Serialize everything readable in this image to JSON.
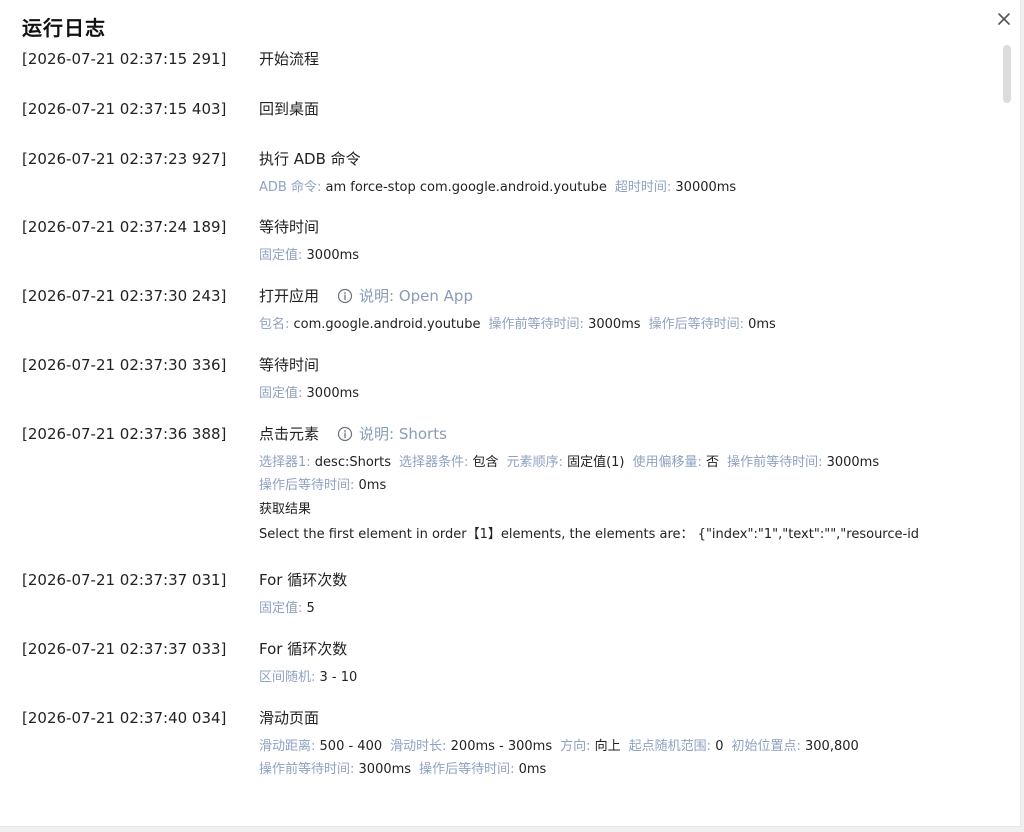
{
  "dialog": {
    "title": "运行日志"
  },
  "log": [
    {
      "ts": "[2026-07-21 02:37:15 291]",
      "title": "开始流程"
    },
    {
      "ts": "[2026-07-21 02:37:15 403]",
      "title": "回到桌面"
    },
    {
      "ts": "[2026-07-21 02:37:23 927]",
      "title": "执行 ADB 命令",
      "line1": [
        {
          "k": "ADB 命令:",
          "v": "am force-stop com.google.android.youtube"
        },
        {
          "k": "超时时间:",
          "v": "30000ms"
        }
      ]
    },
    {
      "ts": "[2026-07-21 02:37:24 189]",
      "title": "等待时间",
      "line1": [
        {
          "k": "固定值:",
          "v": "3000ms"
        }
      ]
    },
    {
      "ts": "[2026-07-21 02:37:30 243]",
      "title": "打开应用",
      "note": "说明: Open App",
      "line1": [
        {
          "k": "包名:",
          "v": "com.google.android.youtube"
        },
        {
          "k": "操作前等待时间:",
          "v": "3000ms"
        },
        {
          "k": "操作后等待时间:",
          "v": "0ms"
        }
      ]
    },
    {
      "ts": "[2026-07-21 02:37:30 336]",
      "title": "等待时间",
      "line1": [
        {
          "k": "固定值:",
          "v": "3000ms"
        }
      ]
    },
    {
      "ts": "[2026-07-21 02:37:36 388]",
      "title": "点击元素",
      "note": "说明: Shorts",
      "line1": [
        {
          "k": "选择器1:",
          "v": "desc:Shorts"
        },
        {
          "k": "选择器条件:",
          "v": "包含"
        },
        {
          "k": "元素顺序:",
          "v": "固定值(1)"
        },
        {
          "k": "使用偏移量:",
          "v": "否"
        },
        {
          "k": "操作前等待时间:",
          "v": "3000ms"
        }
      ],
      "line2": [
        {
          "k": "操作后等待时间:",
          "v": "0ms"
        }
      ],
      "result_label": "获取结果",
      "result_text": "Select the first element in order【1】elements, the elements are： {\"index\":\"1\",\"text\":\"\",\"resource-id..."
    },
    {
      "ts": "[2026-07-21 02:37:37 031]",
      "title": "For 循环次数",
      "line1": [
        {
          "k": "固定值:",
          "v": "5"
        }
      ]
    },
    {
      "ts": "[2026-07-21 02:37:37 033]",
      "title": "For 循环次数",
      "line1": [
        {
          "k": "区间随机:",
          "v": "3 - 10"
        }
      ]
    },
    {
      "ts": "[2026-07-21 02:37:40 034]",
      "title": "滑动页面",
      "line1": [
        {
          "k": "滑动距离:",
          "v": "500 - 400"
        },
        {
          "k": "滑动时长:",
          "v": "200ms - 300ms"
        },
        {
          "k": "方向:",
          "v": "向上"
        },
        {
          "k": "起点随机范围:",
          "v": "0"
        },
        {
          "k": "初始位置点:",
          "v": "300,800"
        }
      ],
      "line2": [
        {
          "k": "操作前等待时间:",
          "v": "3000ms"
        },
        {
          "k": "操作后等待时间:",
          "v": "0ms"
        }
      ]
    }
  ],
  "icons": {
    "close": "close-icon",
    "note": "info-circle-icon"
  },
  "colors": {
    "key": "#8fa2c2",
    "note": "#8a9bb8",
    "text": "#222222"
  }
}
